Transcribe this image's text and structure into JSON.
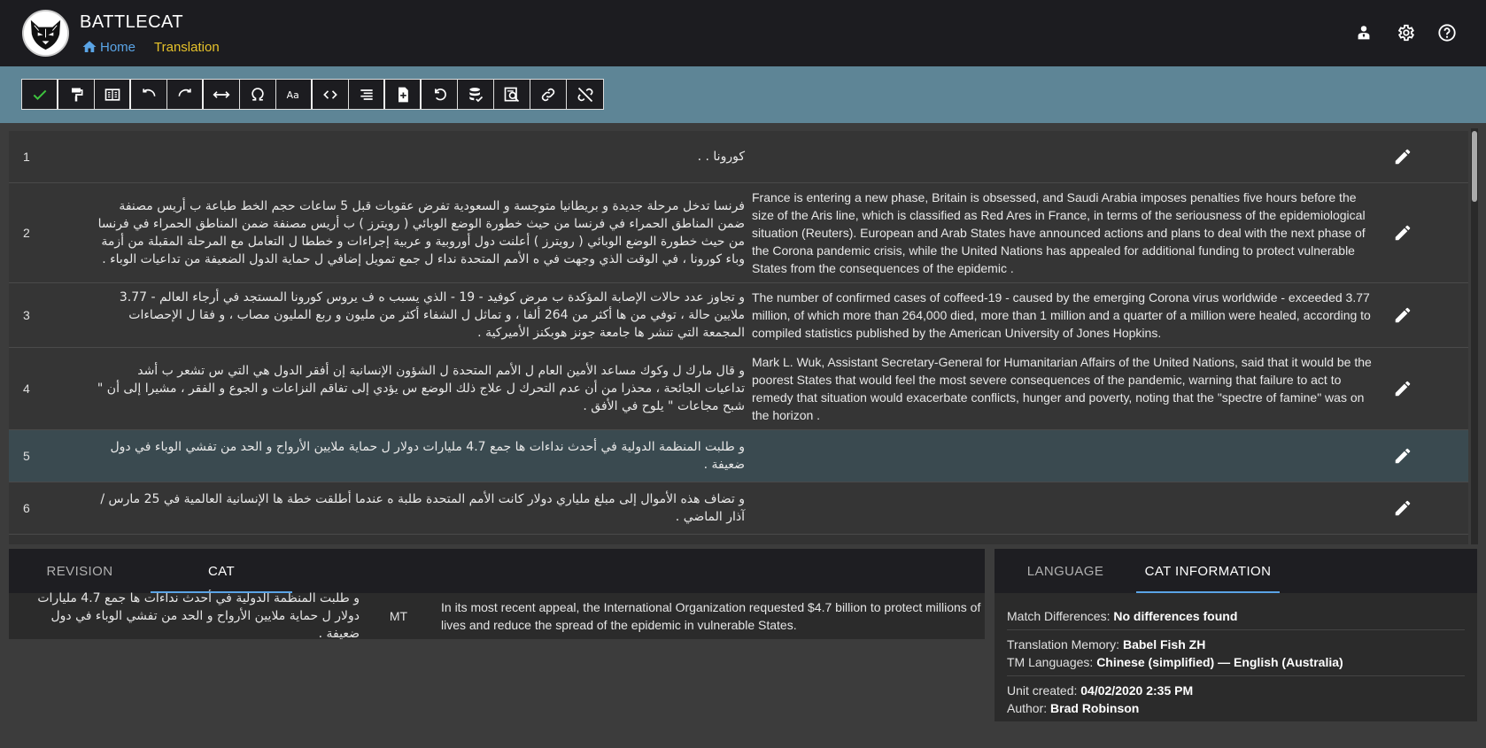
{
  "app": {
    "title": "BATTLECAT",
    "logo": "panther-logo"
  },
  "breadcrumb": {
    "home": "Home",
    "current": "Translation"
  },
  "header_icons": [
    "user-icon",
    "gear-icon",
    "help-icon"
  ],
  "toolbar": [
    "check-icon",
    "paint-format-icon",
    "split-view-icon",
    "undo-icon",
    "redo-icon",
    "width-icon",
    "omega-icon",
    "font-case-icon",
    "code-icon",
    "align-icon",
    "add-document-icon",
    "revert-icon",
    "database-check-icon",
    "search-document-icon",
    "link-icon",
    "unlink-icon"
  ],
  "segments": [
    {
      "num": "1",
      "source": "كورونا . .",
      "target": ""
    },
    {
      "num": "2",
      "source": "فرنسا تدخل مرحلة جديدة و بريطانيا متوجسة و السعودية تفرض عقوبات قبل 5 ساعات حجم الخط طباعة ب أريس مصنفة ضمن المناطق الحمراء في فرنسا من حيث خطورة الوضع الوبائي ( رويترز ) ب أريس مصنفة ضمن المناطق الحمراء في فرنسا من حيث خطورة الوضع الوبائي ( رويترز ) أعلنت دول أوروبية و عربية إجراءات و خططا ل التعامل مع المرحلة المقبلة من أزمة وباء كورونا ، في الوقت الذي وجهت في ه الأمم المتحدة نداء ل جمع تمويل إضافي ل حماية الدول الضعيفة من تداعيات الوباء .",
      "target": "France is entering a new phase, Britain is obsessed, and Saudi Arabia imposes penalties five hours before the size of the Aris line, which is classified as Red Ares in France, in terms of the seriousness of the epidemiological situation (Reuters). European and Arab States have announced actions and plans to deal with the next phase of the Corona pandemic crisis, while the United Nations has appealed for additional funding to protect vulnerable States from the consequences of the epidemic ."
    },
    {
      "num": "3",
      "source": "و تجاوز عدد حالات الإصابة المؤكدة ب مرض كوفيد - 19 - الذي يسبب ه ف يروس كورونا المستجد في أرجاء العالم - 3.77 ملايين حالة ، توفي من ها أكثر من 264 ألفا ، و تماثل ل الشفاء أكثر من مليون و ربع المليون مصاب ، و فقا ل الإحصاءات المجمعة التي تنشر ها جامعة جونز هوبكنز الأميركية .",
      "target": "The number of confirmed cases of coffeed-19 - caused by the emerging Corona virus worldwide - exceeded 3.77 million, of which more than 264,000 died, more than 1 million and a quarter of a million were healed, according to compiled statistics published by the American University of Jones Hopkins."
    },
    {
      "num": "4",
      "source": "و قال مارك ل وكوك مساعد الأمين العام ل الأمم المتحدة ل الشؤون الإنسانية إن أفقر الدول هي التي س تشعر ب أشد تداعيات الجائحة ، محذرا من أن عدم التحرك ل علاج ذلك الوضع س يؤدي إلى تفاقم النزاعات و الجوع و الفقر ، مشيرا إلى أن \" شبح مجاعات \" يلوح في الأفق .",
      "target": "Mark L. Wuk, Assistant Secretary-General for Humanitarian Affairs of the United Nations, said that it would be the poorest States that would feel the most severe consequences of the pandemic, warning that failure to act to remedy that situation would exacerbate conflicts, hunger and poverty, noting that the \"spectre of famine\" was on the horizon ."
    },
    {
      "num": "5",
      "source": "و طلبت المنظمة الدولية في أحدث نداءات ها جمع 4.7 مليارات دولار ل حماية ملايين الأرواح و الحد من تفشي الوباء في دول ضعيفة .",
      "target": ""
    },
    {
      "num": "6",
      "source": "و تضاف هذه الأموال إلى مبلغ ملياري دولار كانت الأمم المتحدة طلبة ه عندما أطلقت خطة ها الإنسانية العالمية في 25 مارس / آذار الماضي .",
      "target": ""
    }
  ],
  "left_panel": {
    "tabs": [
      "REVISION",
      "CAT"
    ],
    "active_tab": "CAT",
    "match": {
      "source": "و طلبت المنظمة الدولية في أحدث نداءات ها جمع 4.7 مليارات دولار ل حماية ملايين الأرواح و الحد من تفشي الوباء في دول ضعيفة .",
      "origin": "MT",
      "target": "In its most recent appeal, the International Organization requested $4.7 billion to protect millions of lives and reduce the spread of the epidemic in vulnerable States."
    }
  },
  "right_panel": {
    "tabs": [
      "LANGUAGE",
      "CAT INFORMATION"
    ],
    "active_tab": "CAT INFORMATION",
    "match_differences_label": "Match Differences:",
    "match_differences_value": "No differences found",
    "tm_label": "Translation Memory:",
    "tm_value": "Babel Fish ZH",
    "tm_languages_label": "TM Languages:",
    "tm_languages_value": "Chinese (simplified) — English (Australia)",
    "unit_created_label": "Unit created:",
    "unit_created_value": "04/02/2020 2:35 PM",
    "author_label": "Author:",
    "author_value": "Brad Robinson"
  },
  "colors": {
    "accent": "#5aa4e6",
    "breadcrumb_current": "#e6c22b",
    "toolbar_strip": "#5e8596",
    "check": "#3ec43e"
  }
}
